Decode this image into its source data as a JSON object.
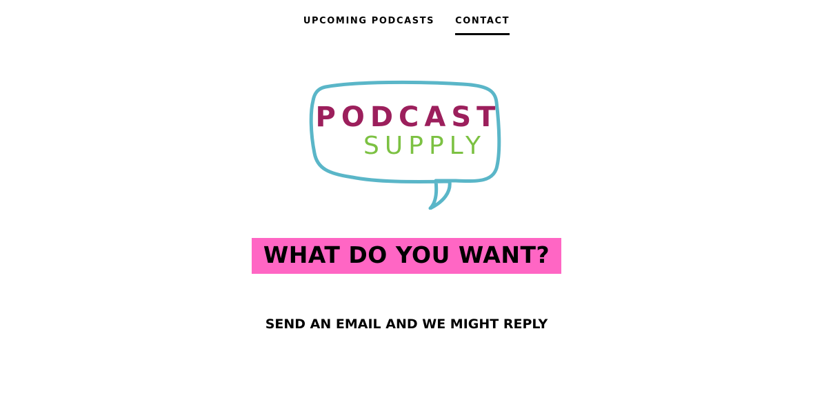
{
  "nav": {
    "items": [
      {
        "label": "UPCOMING PODCASTS",
        "active": false
      },
      {
        "label": "CONTACT",
        "active": true
      }
    ]
  },
  "logo": {
    "line1": "PODCAST",
    "line2": "SUPPLY",
    "colors": {
      "bubble": "#5ab6c8",
      "line1": "#9c1f5c",
      "line2": "#7cc142"
    }
  },
  "main": {
    "headline": "WHAT DO YOU WANT?",
    "headline_bg": "#ff66c4",
    "subline": "SEND AN EMAIL AND WE MIGHT REPLY"
  }
}
